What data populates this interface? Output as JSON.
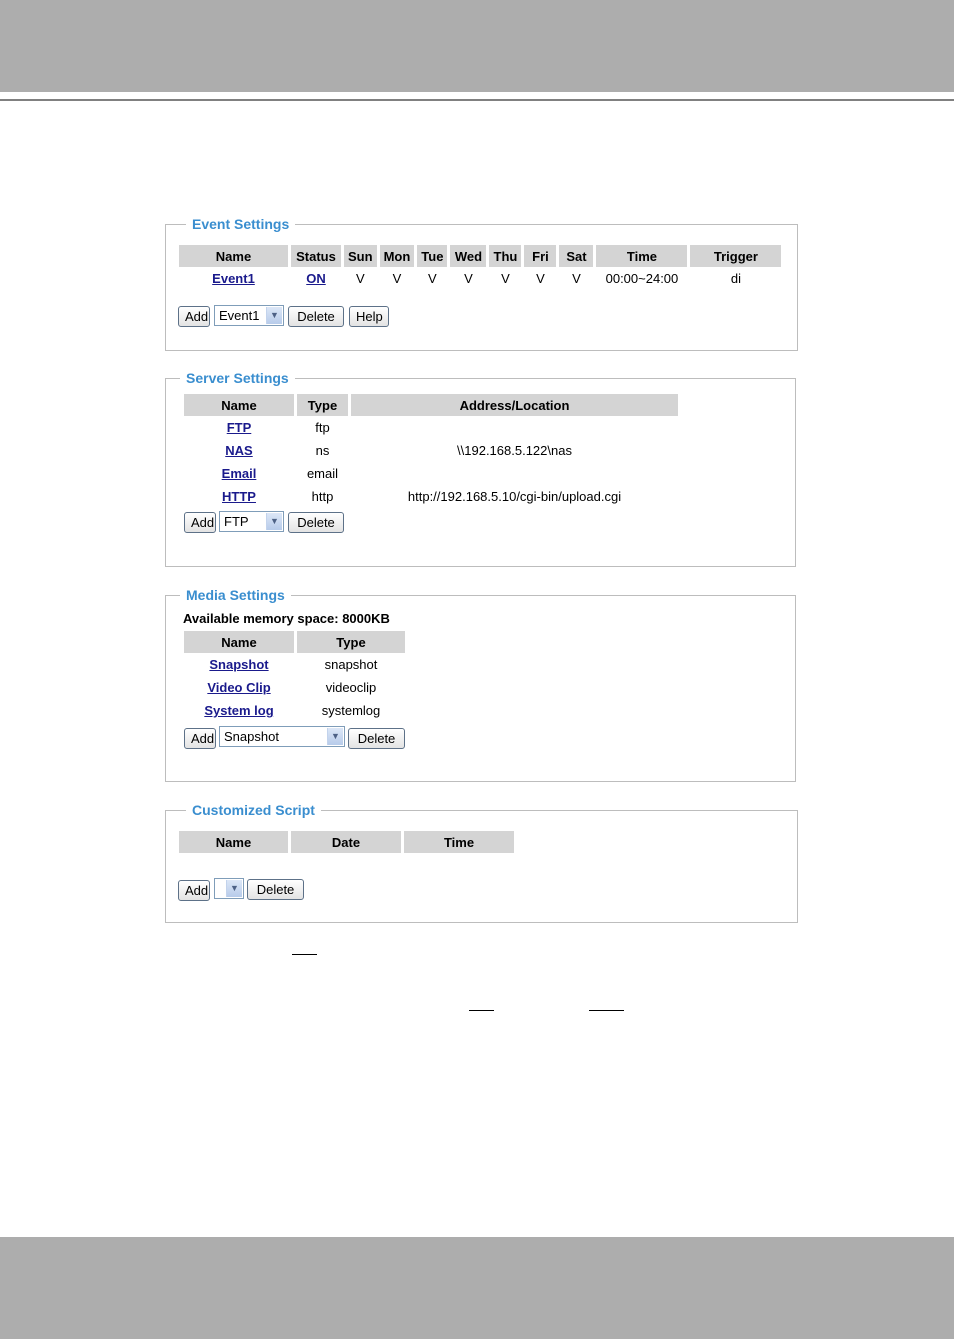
{
  "event": {
    "legend": "Event Settings",
    "headers": [
      "Name",
      "Status",
      "Sun",
      "Mon",
      "Tue",
      "Wed",
      "Thu",
      "Fri",
      "Sat",
      "Time",
      "Trigger"
    ],
    "rows": [
      {
        "name": "Event1",
        "status": "ON",
        "sun": "V",
        "mon": "V",
        "tue": "V",
        "wed": "V",
        "thu": "V",
        "fri": "V",
        "sat": "V",
        "time": "00:00~24:00",
        "trigger": "di"
      }
    ],
    "add_label": "Add",
    "select_value": "Event1",
    "delete_label": "Delete",
    "help_label": "Help"
  },
  "server": {
    "legend": "Server Settings",
    "headers": [
      "Name",
      "Type",
      "Address/Location"
    ],
    "rows": [
      {
        "name": "FTP",
        "type": "ftp",
        "address": ""
      },
      {
        "name": "NAS",
        "type": "ns",
        "address": "\\\\192.168.5.122\\nas"
      },
      {
        "name": "Email",
        "type": "email",
        "address": ""
      },
      {
        "name": "HTTP",
        "type": "http",
        "address": "http://192.168.5.10/cgi-bin/upload.cgi"
      }
    ],
    "add_label": "Add",
    "select_value": "FTP",
    "delete_label": "Delete"
  },
  "media": {
    "legend": "Media Settings",
    "memory_text": "Available memory space: 8000KB",
    "headers": [
      "Name",
      "Type"
    ],
    "rows": [
      {
        "name": "Snapshot",
        "type": "snapshot"
      },
      {
        "name": "Video Clip",
        "type": "videoclip"
      },
      {
        "name": "System log",
        "type": "systemlog"
      }
    ],
    "add_label": "Add",
    "select_value": "Snapshot",
    "delete_label": "Delete"
  },
  "script": {
    "legend": "Customized Script",
    "headers": [
      "Name",
      "Date",
      "Time"
    ],
    "add_label": "Add",
    "select_value": "",
    "delete_label": "Delete"
  }
}
